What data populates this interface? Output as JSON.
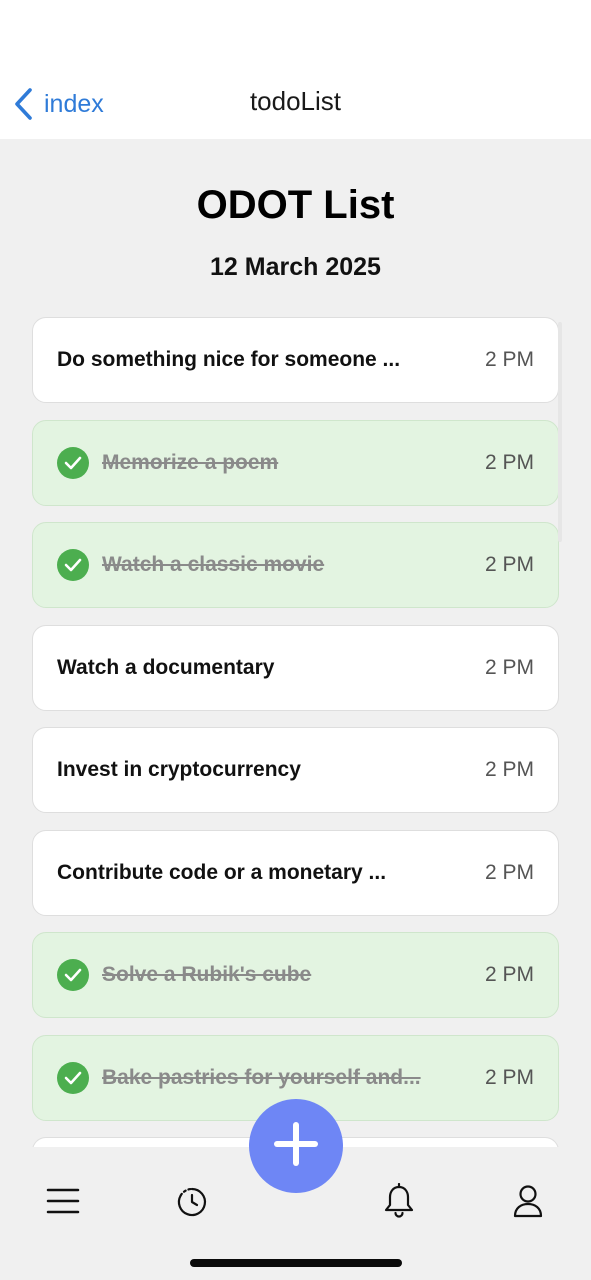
{
  "nav": {
    "back_label": "index",
    "title": "todoList"
  },
  "header": {
    "title": "ODOT List",
    "date": "12 March 2025"
  },
  "tasks": [
    {
      "title": "Do something nice for someone ...",
      "time": "2 PM",
      "completed": false
    },
    {
      "title": "Memorize a poem",
      "time": "2 PM",
      "completed": true
    },
    {
      "title": "Watch a classic movie",
      "time": "2 PM",
      "completed": true
    },
    {
      "title": "Watch a documentary",
      "time": "2 PM",
      "completed": false
    },
    {
      "title": "Invest in cryptocurrency",
      "time": "2 PM",
      "completed": false
    },
    {
      "title": "Contribute code or a monetary ...",
      "time": "2 PM",
      "completed": false
    },
    {
      "title": "Solve a Rubik's cube",
      "time": "2 PM",
      "completed": true
    },
    {
      "title": "Bake pastries for yourself and...",
      "time": "2 PM",
      "completed": true
    }
  ],
  "tab_bar": {
    "items": [
      "menu-icon",
      "history-icon",
      "bell-icon",
      "profile-icon"
    ],
    "fab_icon": "plus-icon"
  },
  "colors": {
    "accent": "#2f7bd8",
    "fab": "#6e86f5",
    "done_bg": "#e3f4e1",
    "check": "#4cae4f"
  }
}
